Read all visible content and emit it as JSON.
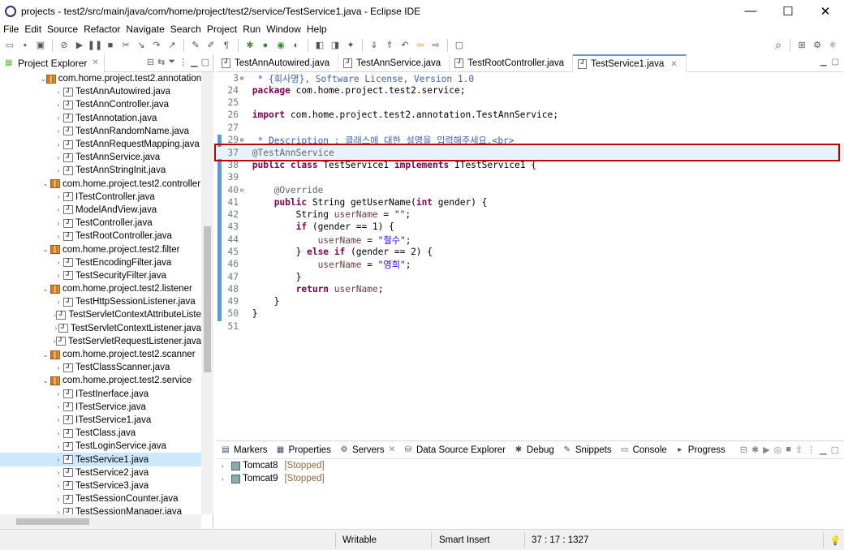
{
  "window": {
    "title": "projects - test2/src/main/java/com/home/project/test2/service/TestService1.java - Eclipse IDE",
    "min": "—",
    "max": "☐",
    "close": "✕"
  },
  "menu": [
    "File",
    "Edit",
    "Source",
    "Refactor",
    "Navigate",
    "Search",
    "Project",
    "Run",
    "Window",
    "Help"
  ],
  "explorer": {
    "title": "Project Explorer",
    "close": "✕",
    "tree": [
      {
        "label": "com.home.project.test2.annotation",
        "type": "package",
        "expanded": true
      },
      {
        "label": "TestAnnAutowired.java",
        "type": "file"
      },
      {
        "label": "TestAnnController.java",
        "type": "file"
      },
      {
        "label": "TestAnnotation.java",
        "type": "file"
      },
      {
        "label": "TestAnnRandomName.java",
        "type": "file"
      },
      {
        "label": "TestAnnRequestMapping.java",
        "type": "file"
      },
      {
        "label": "TestAnnService.java",
        "type": "file"
      },
      {
        "label": "TestAnnStringInit.java",
        "type": "file"
      },
      {
        "label": "com.home.project.test2.controller",
        "type": "package",
        "expanded": true
      },
      {
        "label": "ITestController.java",
        "type": "file"
      },
      {
        "label": "ModelAndView.java",
        "type": "file"
      },
      {
        "label": "TestController.java",
        "type": "file"
      },
      {
        "label": "TestRootController.java",
        "type": "file"
      },
      {
        "label": "com.home.project.test2.filter",
        "type": "package",
        "expanded": true
      },
      {
        "label": "TestEncodingFilter.java",
        "type": "file"
      },
      {
        "label": "TestSecurityFilter.java",
        "type": "file"
      },
      {
        "label": "com.home.project.test2.listener",
        "type": "package",
        "expanded": true
      },
      {
        "label": "TestHttpSessionListener.java",
        "type": "file"
      },
      {
        "label": "TestServletContextAttributeListe",
        "type": "file"
      },
      {
        "label": "TestServletContextListener.java",
        "type": "file"
      },
      {
        "label": "TestServletRequestListener.java",
        "type": "file"
      },
      {
        "label": "com.home.project.test2.scanner",
        "type": "package",
        "expanded": true
      },
      {
        "label": "TestClassScanner.java",
        "type": "file"
      },
      {
        "label": "com.home.project.test2.service",
        "type": "package",
        "expanded": true
      },
      {
        "label": "ITestInerface.java",
        "type": "file"
      },
      {
        "label": "ITestService.java",
        "type": "file"
      },
      {
        "label": "ITestService1.java",
        "type": "file"
      },
      {
        "label": "TestClass.java",
        "type": "file"
      },
      {
        "label": "TestLoginService.java",
        "type": "file"
      },
      {
        "label": "TestService1.java",
        "type": "file",
        "selected": true
      },
      {
        "label": "TestService2.java",
        "type": "file"
      },
      {
        "label": "TestService3.java",
        "type": "file"
      },
      {
        "label": "TestSessionCounter.java",
        "type": "file"
      },
      {
        "label": "TestSessionManager.java",
        "type": "file"
      }
    ]
  },
  "editor_tabs": [
    {
      "label": "TestAnnAutowired.java",
      "active": false
    },
    {
      "label": "TestAnnService.java",
      "active": false
    },
    {
      "label": "TestRootController.java",
      "active": false
    },
    {
      "label": "TestService1.java",
      "active": true
    }
  ],
  "code_lines": [
    {
      "num": "3",
      "fold": "⊕",
      "html": "<span class=\"cm\"> * {회사명}, Software License, Version 1.0</span>"
    },
    {
      "num": "24",
      "fold": "",
      "html": "<span class=\"kw\">package</span> com.home.project.test2.service;"
    },
    {
      "num": "25",
      "fold": "",
      "html": ""
    },
    {
      "num": "26",
      "fold": "",
      "html": "<span class=\"kw\">import</span> com.home.project.test2.annotation.TestAnnService;"
    },
    {
      "num": "27",
      "fold": "",
      "html": ""
    },
    {
      "num": "29",
      "fold": "⊕",
      "html": "<span class=\"cm\"> * Description : 클래스에 대한 설명을 입력해주세요.&lt;br&gt;</span>"
    },
    {
      "num": "37",
      "fold": "",
      "html": "<span class=\"ann\">@TestAnnService</span>",
      "highlight": true
    },
    {
      "num": "38",
      "fold": "",
      "html": "<span class=\"kw\">public class</span> TestService1 <span class=\"kw\">implements</span> ITestService1 {"
    },
    {
      "num": "39",
      "fold": "",
      "html": ""
    },
    {
      "num": "40",
      "fold": "⊖",
      "html": "    <span class=\"ann\">@Override</span>"
    },
    {
      "num": "41",
      "fold": "",
      "html": "    <span class=\"kw\">public</span> String getUserName(<span class=\"kw\">int</span> gender) {"
    },
    {
      "num": "42",
      "fold": "",
      "html": "        String <span class=\"var\">userName</span> = <span class=\"str\">\"\"</span>;"
    },
    {
      "num": "43",
      "fold": "",
      "html": "        <span class=\"kw\">if</span> (gender == 1) {"
    },
    {
      "num": "44",
      "fold": "",
      "html": "            <span class=\"var\">userName</span> = <span class=\"str\">\"철수\"</span>;"
    },
    {
      "num": "45",
      "fold": "",
      "html": "        } <span class=\"kw\">else if</span> (gender == 2) {"
    },
    {
      "num": "46",
      "fold": "",
      "html": "            <span class=\"var\">userName</span> = <span class=\"str\">\"영희\"</span>;"
    },
    {
      "num": "47",
      "fold": "",
      "html": "        }"
    },
    {
      "num": "48",
      "fold": "",
      "html": "        <span class=\"kw\">return</span> <span class=\"var\">userName</span>;"
    },
    {
      "num": "49",
      "fold": "",
      "html": "    }"
    },
    {
      "num": "50",
      "fold": "",
      "html": "}"
    },
    {
      "num": "51",
      "fold": "",
      "html": ""
    }
  ],
  "bottom_tabs": [
    {
      "label": "Markers",
      "icon": "▤"
    },
    {
      "label": "Properties",
      "icon": "▦"
    },
    {
      "label": "Servers",
      "icon": "⚙",
      "active": true
    },
    {
      "label": "Data Source Explorer",
      "icon": "⛁"
    },
    {
      "label": "Debug",
      "icon": "✱"
    },
    {
      "label": "Snippets",
      "icon": "✎"
    },
    {
      "label": "Console",
      "icon": "▭"
    },
    {
      "label": "Progress",
      "icon": "▸"
    }
  ],
  "servers": [
    {
      "name": "Tomcat8",
      "state": "[Stopped]"
    },
    {
      "name": "Tomcat9",
      "state": "[Stopped]"
    }
  ],
  "status": {
    "writable": "Writable",
    "insert": "Smart Insert",
    "position": "37 : 17 : 1327"
  }
}
